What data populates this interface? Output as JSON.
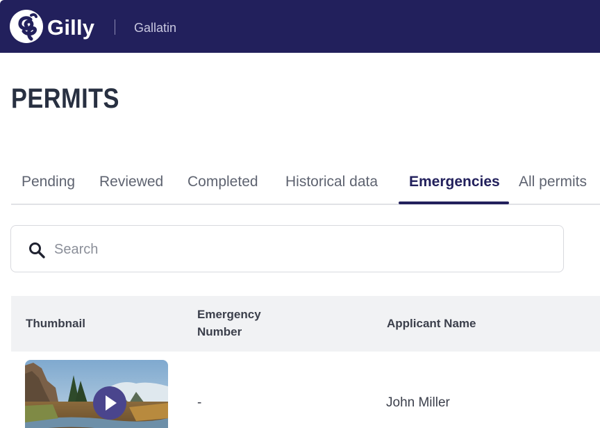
{
  "header": {
    "brand_name": "Gilly",
    "org_name": "Gallatin",
    "bg_color": "#22205c",
    "logo_icon": "gilly-logo-icon"
  },
  "page": {
    "title": "PERMITS"
  },
  "tabs": [
    {
      "label": "Pending",
      "active": false
    },
    {
      "label": "Reviewed",
      "active": false
    },
    {
      "label": "Completed",
      "active": false
    },
    {
      "label": "Historical data",
      "active": false
    },
    {
      "label": "Emergencies",
      "active": true
    },
    {
      "label": "All permits",
      "active": false
    }
  ],
  "search": {
    "placeholder": "Search",
    "value": "",
    "icon": "search-icon"
  },
  "table": {
    "columns": [
      {
        "label": "Thumbnail"
      },
      {
        "label": "Emergency Number"
      },
      {
        "label": "Applicant Name"
      }
    ],
    "rows": [
      {
        "thumbnail_icon": "play-icon",
        "emergency_number": "-",
        "applicant_name": "John Miller"
      }
    ]
  },
  "colors": {
    "accent": "#22205c",
    "play_button": "#4a458d",
    "header_row_bg": "#f1f2f4"
  }
}
